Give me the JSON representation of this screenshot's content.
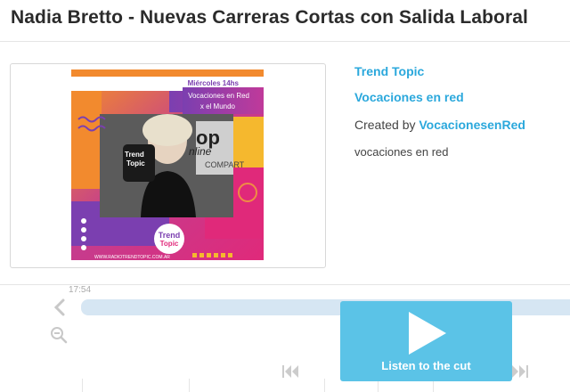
{
  "page": {
    "title": "Nadia Bretto - Nuevas Carreras Cortas con Salida Laboral"
  },
  "cover": {
    "day_label": "Miércoles 14hs",
    "show_line1": "Vocaciones en Red",
    "show_line2": "x el Mundo",
    "logo_line1": "Trend",
    "logo_line2": "Topic",
    "website": "WWW.RADIOTRENDTOPIC.COM.AR",
    "mic_text_1": "Trend",
    "mic_text_2": "Topic",
    "bg_text_1": "op",
    "bg_text_2": "nline",
    "bg_text_3": "COMPART",
    "colors": {
      "orange": "#f28a2e",
      "purple": "#7b3fb0",
      "magenta": "#e0297a",
      "yellow": "#f5b82e"
    }
  },
  "meta": {
    "brand": "Trend Topic",
    "show": "Vocaciones en red",
    "created_prefix": "Created by",
    "creator": "VocacionesenRed",
    "tag": "vocaciones en red"
  },
  "player": {
    "time": "17:54",
    "listen_label": "Listen to the cut",
    "accent": "#5bc3e7"
  }
}
